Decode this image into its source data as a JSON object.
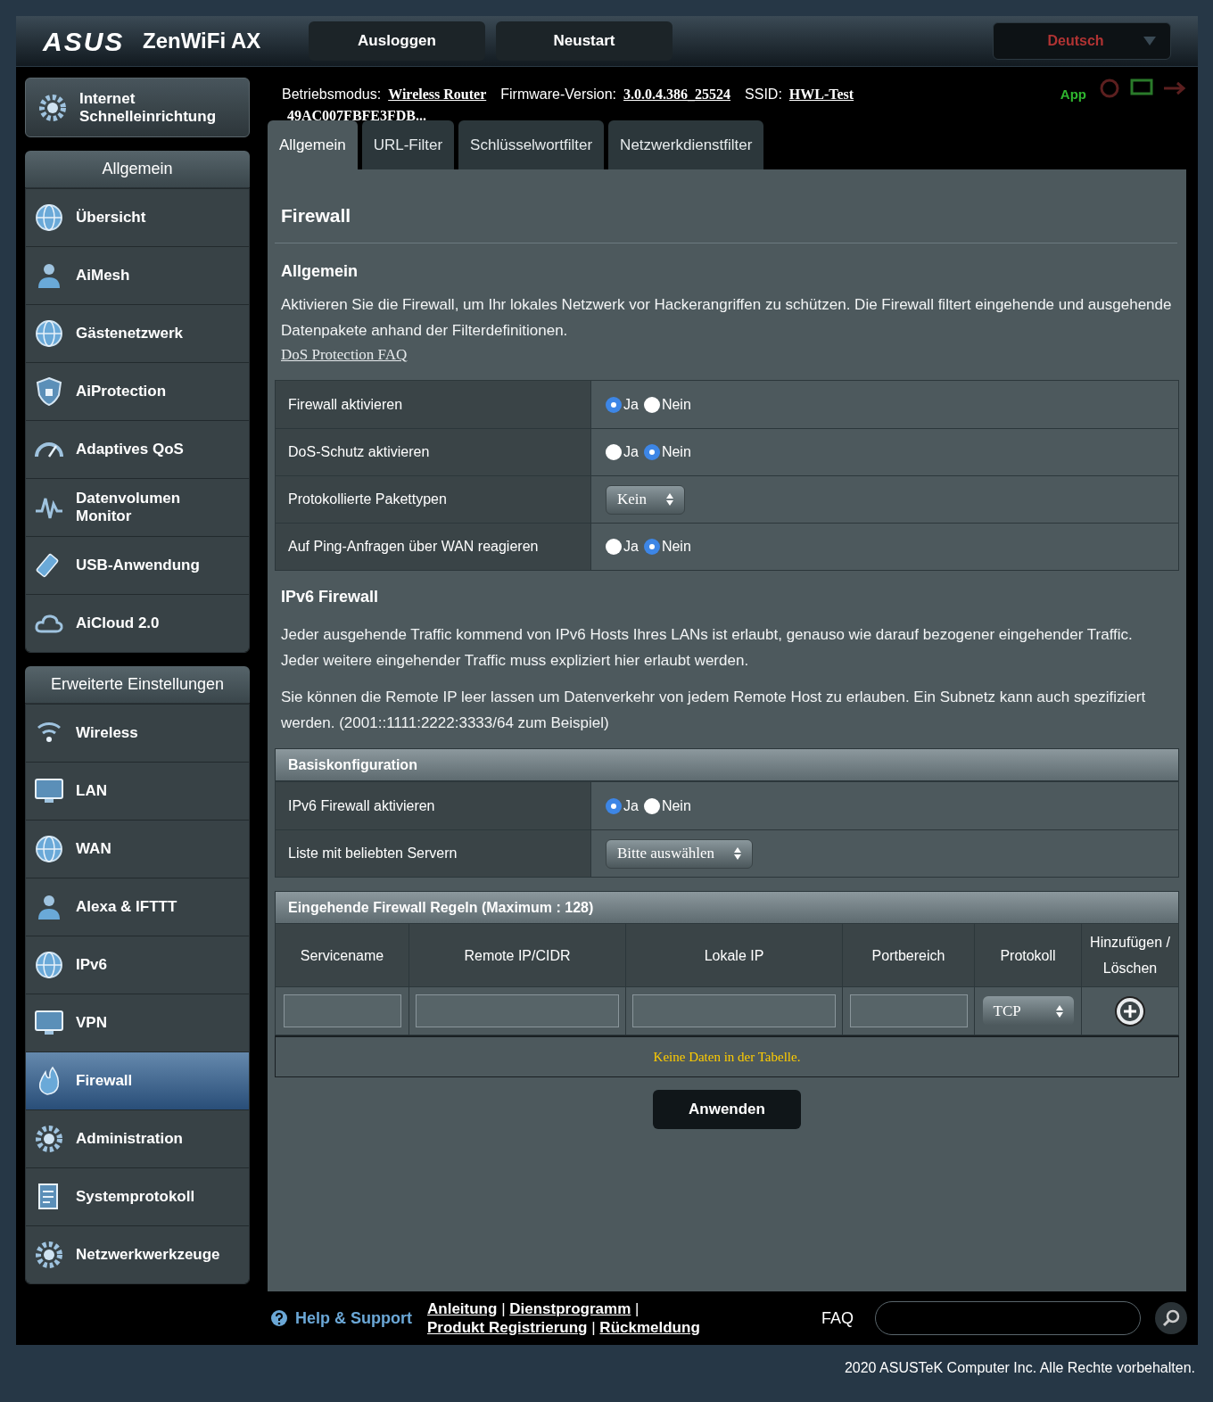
{
  "header": {
    "logo": "ASUS",
    "product": "ZenWiFi AX",
    "buttons": [
      "Ausloggen",
      "Neustart"
    ],
    "language": "Deutsch"
  },
  "info": {
    "mode_label": "Betriebsmodus:",
    "mode": "Wireless Router",
    "firmware_label": "Firmware-Version:",
    "firmware": "3.0.0.4.386_25524",
    "ssid_label": "SSID:",
    "ssid": "HWL-Test",
    "ssid2": "49AC007FBFE3FDB...",
    "app": "App"
  },
  "sidebar": {
    "quick_setup": "Internet Schnelleinrichtung",
    "sections": [
      {
        "title": "Allgemein",
        "items": [
          {
            "label": "Übersicht",
            "selected": false
          },
          {
            "label": "AiMesh",
            "selected": false
          },
          {
            "label": "Gästenetzwerk",
            "selected": false
          },
          {
            "label": "AiProtection",
            "selected": false
          },
          {
            "label": "Adaptives QoS",
            "selected": false
          },
          {
            "label": "Datenvolumen Monitor",
            "selected": false
          },
          {
            "label": "USB-Anwendung",
            "selected": false
          },
          {
            "label": "AiCloud 2.0",
            "selected": false
          }
        ]
      },
      {
        "title": "Erweiterte Einstellungen",
        "items": [
          {
            "label": "Wireless",
            "selected": false
          },
          {
            "label": "LAN",
            "selected": false
          },
          {
            "label": "WAN",
            "selected": false
          },
          {
            "label": "Alexa & IFTTT",
            "selected": false
          },
          {
            "label": "IPv6",
            "selected": false
          },
          {
            "label": "VPN",
            "selected": false
          },
          {
            "label": "Firewall",
            "selected": true
          },
          {
            "label": "Administration",
            "selected": false
          },
          {
            "label": "Systemprotokoll",
            "selected": false
          },
          {
            "label": "Netzwerkwerkzeuge",
            "selected": false
          }
        ]
      }
    ]
  },
  "tabs": [
    {
      "label": "Allgemein",
      "selected": true
    },
    {
      "label": "URL-Filter",
      "selected": false
    },
    {
      "label": "Schlüsselwortfilter",
      "selected": false
    },
    {
      "label": "Netzwerkdienstfilter",
      "selected": false
    }
  ],
  "page_title": "Firewall",
  "general": {
    "heading": "Allgemein",
    "text": "Aktivieren Sie die Firewall, um Ihr lokales Netzwerk vor Hackerangriffen zu schützen. Die Firewall filtert eingehende und ausgehende Datenpakete anhand der Filterdefinitionen.",
    "link": "DoS Protection FAQ",
    "settings": [
      {
        "label": "Firewall aktivieren",
        "kind": "radio",
        "options": [
          {
            "label": "Ja",
            "selected": true
          },
          {
            "label": "Nein",
            "selected": false
          }
        ]
      },
      {
        "label": "DoS-Schutz aktivieren",
        "kind": "radio",
        "options": [
          {
            "label": "Ja",
            "selected": false
          },
          {
            "label": "Nein",
            "selected": true
          }
        ]
      },
      {
        "label": "Protokollierte Pakettypen",
        "kind": "select",
        "value": "Kein"
      },
      {
        "label": "Auf Ping-Anfragen über WAN reagieren",
        "kind": "radio",
        "options": [
          {
            "label": "Ja",
            "selected": false
          },
          {
            "label": "Nein",
            "selected": true
          }
        ]
      }
    ]
  },
  "ipv6": {
    "heading": "IPv6 Firewall",
    "paragraphs": [
      "Jeder ausgehende Traffic kommend von IPv6 Hosts Ihres LANs ist erlaubt, genauso wie darauf bezogener eingehender Traffic. Jeder weitere eingehender Traffic muss expliziert hier erlaubt werden.",
      "Sie können die Remote IP leer lassen um Datenverkehr von jedem Remote Host zu erlauben. Ein Subnetz kann auch spezifiziert werden. (2001::1111:2222:3333/64 zum Beispiel)"
    ],
    "basic": {
      "title": "Basiskonfiguration",
      "settings": [
        {
          "label": "IPv6 Firewall aktivieren",
          "kind": "radio",
          "options": [
            {
              "label": "Ja",
              "selected": true
            },
            {
              "label": "Nein",
              "selected": false
            }
          ]
        },
        {
          "label": "Liste mit beliebten Servern",
          "kind": "select",
          "value": "Bitte auswählen"
        }
      ]
    },
    "rules": {
      "title": "Eingehende Firewall Regeln (Maximum : 128)",
      "columns": [
        "Servicename",
        "Remote IP/CIDR",
        "Lokale IP",
        "Portbereich",
        "Protokoll",
        "Hinzufügen / Löschen"
      ],
      "protocol": "TCP",
      "empty": "Keine Daten in der Tabelle."
    }
  },
  "apply": "Anwenden",
  "footer": {
    "help": "Help & Support",
    "links": [
      "Anleitung",
      "Dienstprogramm",
      "Produkt Registrierung",
      "Rückmeldung"
    ],
    "separator": "|",
    "faq": "FAQ",
    "copyright": "2020 ASUSTeK Computer Inc. Alle Rechte vorbehalten."
  }
}
